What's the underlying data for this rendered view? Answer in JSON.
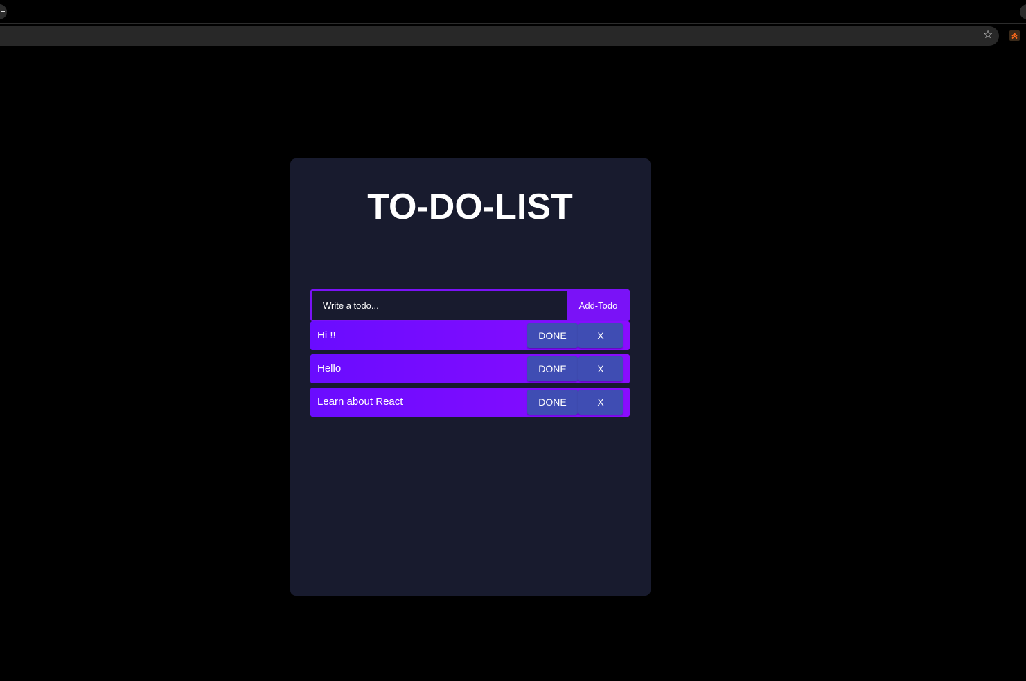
{
  "browser": {
    "star_icon": "star-icon",
    "extension_icon": "extension-icon"
  },
  "app": {
    "title": "TO-DO-LIST",
    "input_placeholder": "Write a todo...",
    "add_button_label": "Add-Todo",
    "colors": {
      "page_background": "#000000",
      "card_background": "#181b2e",
      "accent": "#7a12f7",
      "item_button": "#3f4db3"
    }
  },
  "todos": [
    {
      "text": "Hi !!",
      "done_label": "DONE",
      "delete_label": "X"
    },
    {
      "text": "Hello",
      "done_label": "DONE",
      "delete_label": "X"
    },
    {
      "text": "Learn about React",
      "done_label": "DONE",
      "delete_label": "X"
    }
  ]
}
